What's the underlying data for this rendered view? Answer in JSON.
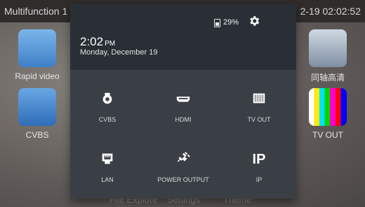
{
  "topbar": {
    "app_title": "Multifunction 1",
    "datetime": "2-19 02:02:52"
  },
  "desktop": {
    "icons": [
      {
        "label": "Rapid video"
      },
      {
        "label": "CVBS"
      },
      {
        "label": "同轴高清"
      },
      {
        "label": "TV OUT"
      }
    ],
    "dock": [
      "File Explore",
      "Settings",
      "Theme"
    ]
  },
  "panel": {
    "battery_pct": "29%",
    "time": "2:02",
    "ampm": "PM",
    "date": "Monday, December 19",
    "tiles": [
      {
        "label": "CVBS",
        "icon": "camera-icon"
      },
      {
        "label": "HDMI",
        "icon": "hdmi-icon"
      },
      {
        "label": "TV OUT",
        "icon": "tv-out-icon"
      },
      {
        "label": "LAN",
        "icon": "lan-icon"
      },
      {
        "label": "POWER OUTPUT",
        "icon": "power-plug-icon"
      },
      {
        "label": "IP",
        "icon": "ip-icon"
      }
    ]
  }
}
